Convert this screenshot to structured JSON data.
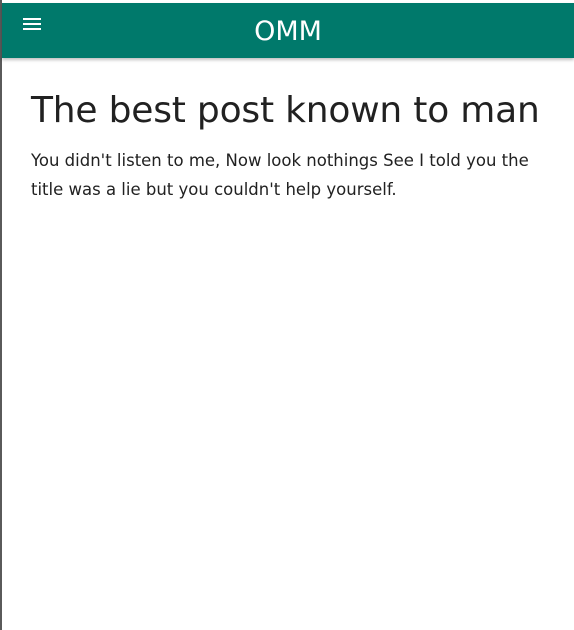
{
  "app_bar": {
    "title": "OMM",
    "menu_icon": "hamburger-menu-icon",
    "color": "#00796b"
  },
  "post": {
    "title": "The best post known to man",
    "body": "You didn't listen to me, Now look nothings See I told you the title was a lie but you couldn't help yourself."
  }
}
